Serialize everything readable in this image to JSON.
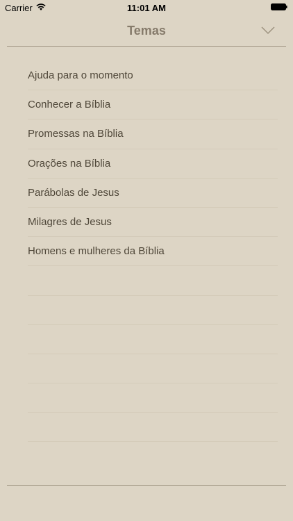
{
  "status_bar": {
    "carrier": "Carrier",
    "time": "11:01 AM"
  },
  "nav": {
    "title": "Temas",
    "dismiss_icon": "chevron-down-icon"
  },
  "topics": [
    "Ajuda para o momento",
    "Conhecer a Bíblia",
    "Promessas na Bíblia",
    "Orações na Bíblia",
    "Parábolas de Jesus",
    "Milagres de Jesus",
    "Homens e mulheres da Bíblia",
    "",
    "",
    "",
    "",
    "",
    ""
  ],
  "colors": {
    "background": "#ddd5c5",
    "title": "#867b6b",
    "text": "#4f4739",
    "separator": "#d4cbb9",
    "rule": "#9d927f"
  }
}
